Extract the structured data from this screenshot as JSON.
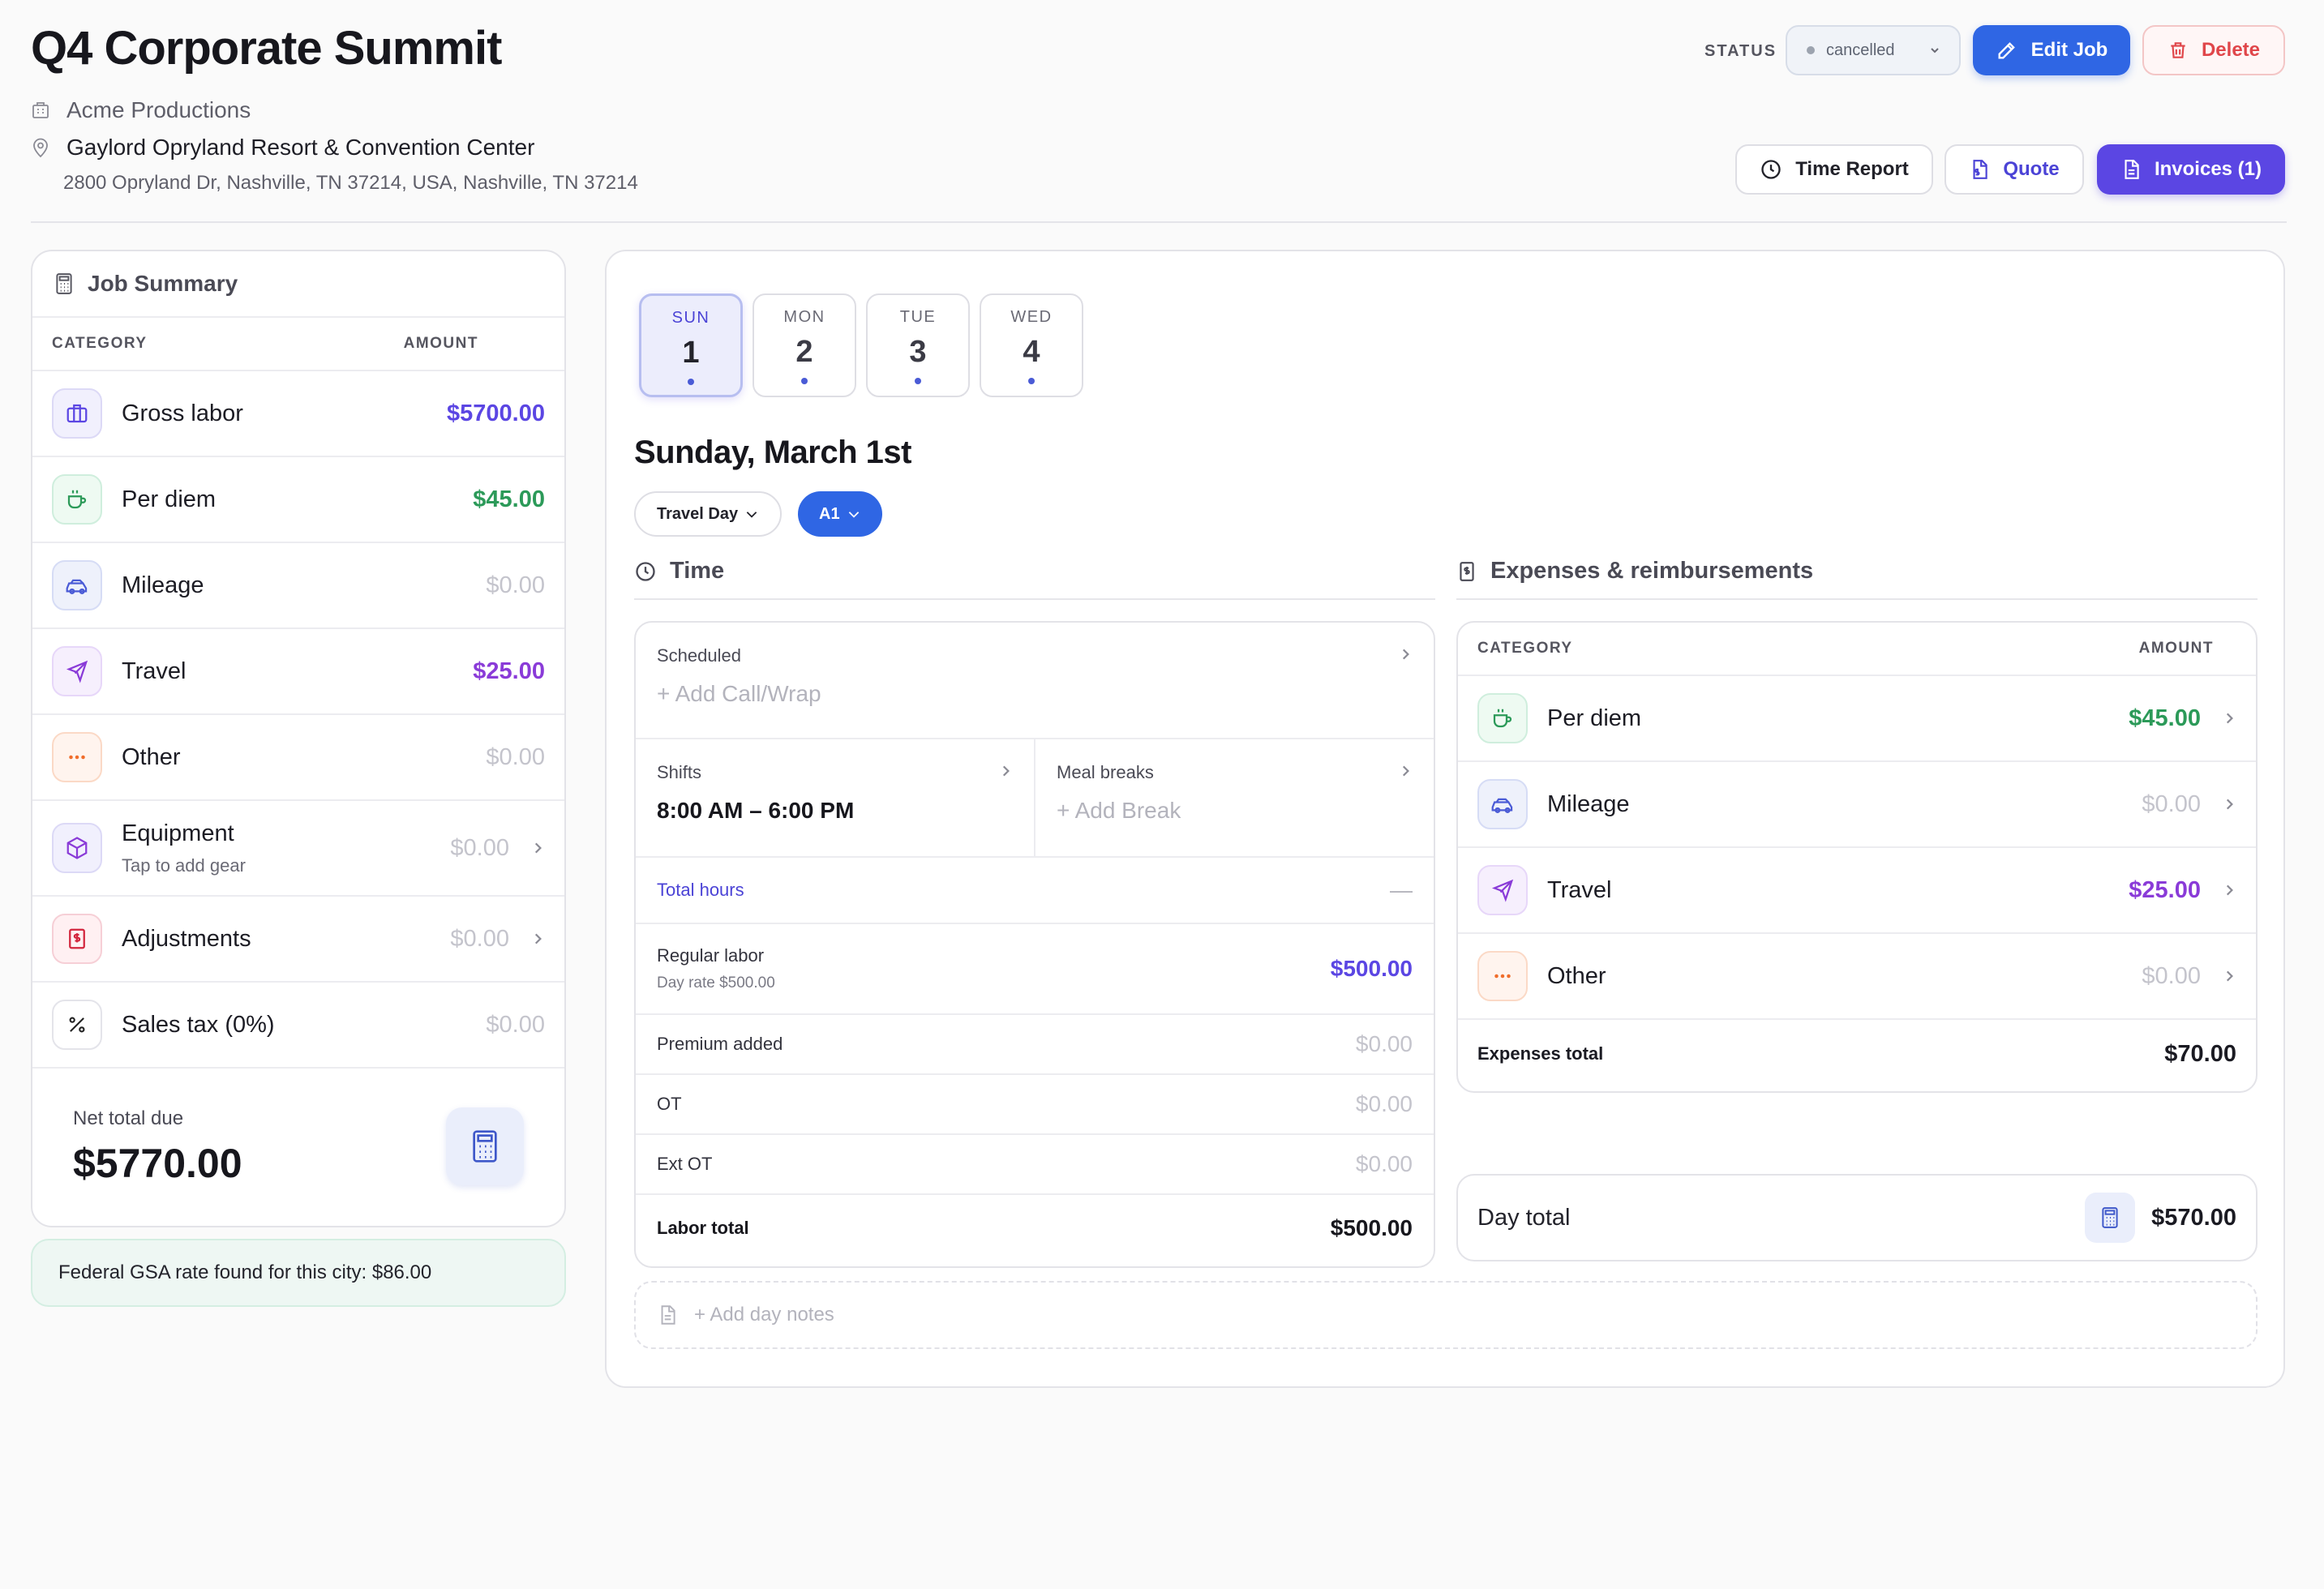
{
  "job": {
    "title": "Q4 Corporate Summit",
    "client": "Acme Productions",
    "venue": "Gaylord Opryland Resort & Convention Center",
    "address": "2800 Opryland Dr, Nashville, TN 37214, USA, Nashville, TN 37214"
  },
  "header": {
    "status_label": "STATUS",
    "status_value": "cancelled",
    "edit_label": "Edit Job",
    "delete_label": "Delete",
    "time_report_label": "Time Report",
    "quote_label": "Quote",
    "invoices_label": "Invoices (1)"
  },
  "summary": {
    "title": "Job Summary",
    "col_category": "CATEGORY",
    "col_amount": "AMOUNT",
    "rows": [
      {
        "label": "Gross labor",
        "amount": "$5700.00",
        "icon": "briefcase-icon"
      },
      {
        "label": "Per diem",
        "amount": "$45.00",
        "icon": "coffee-icon"
      },
      {
        "label": "Mileage",
        "amount": "$0.00",
        "icon": "car-icon"
      },
      {
        "label": "Travel",
        "amount": "$25.00",
        "icon": "plane-icon"
      },
      {
        "label": "Other",
        "amount": "$0.00",
        "icon": "ellipsis-icon"
      },
      {
        "label": "Equipment",
        "sub": "Tap to add gear",
        "amount": "$0.00",
        "icon": "package-icon"
      },
      {
        "label": "Adjustments",
        "amount": "$0.00",
        "icon": "dollar-receipt-icon"
      },
      {
        "label": "Sales tax (0%)",
        "amount": "$0.00",
        "icon": "percent-icon"
      }
    ],
    "net_label": "Net total due",
    "net_value": "$5770.00"
  },
  "gsa_notice": "Federal GSA rate found for this city: $86.00",
  "days": [
    {
      "name": "SUN",
      "num": "1"
    },
    {
      "name": "MON",
      "num": "2"
    },
    {
      "name": "TUE",
      "num": "3"
    },
    {
      "name": "WED",
      "num": "4"
    }
  ],
  "day_view": {
    "title": "Sunday, March 1st",
    "day_type": "Travel Day",
    "position": "A1"
  },
  "time": {
    "section_title": "Time",
    "scheduled_label": "Scheduled",
    "scheduled_placeholder": "+ Add Call/Wrap",
    "shifts_label": "Shifts",
    "shifts_value": "8:00 AM – 6:00 PM",
    "meal_label": "Meal breaks",
    "meal_placeholder": "+ Add Break",
    "total_hours_label": "Total hours",
    "total_hours_value": "—",
    "regular_label": "Regular labor",
    "regular_sub": "Day rate $500.00",
    "regular_value": "$500.00",
    "premium_label": "Premium added",
    "premium_value": "$0.00",
    "ot_label": "OT",
    "ot_value": "$0.00",
    "extot_label": "Ext OT",
    "extot_value": "$0.00",
    "labor_total_label": "Labor total",
    "labor_total_value": "$500.00"
  },
  "expenses": {
    "section_title": "Expenses & reimbursements",
    "col_category": "CATEGORY",
    "col_amount": "AMOUNT",
    "rows": [
      {
        "label": "Per diem",
        "amount": "$45.00"
      },
      {
        "label": "Mileage",
        "amount": "$0.00"
      },
      {
        "label": "Travel",
        "amount": "$25.00"
      },
      {
        "label": "Other",
        "amount": "$0.00"
      }
    ],
    "total_label": "Expenses total",
    "total_value": "$70.00"
  },
  "day_total": {
    "label": "Day total",
    "value": "$570.00"
  },
  "notes_placeholder": "+ Add day notes",
  "colors": {
    "primary_blue": "#2f66e4",
    "indigo": "#5b46e3",
    "green": "#2c9a59",
    "violet": "#8a3bd8",
    "danger": "#e0464a"
  }
}
